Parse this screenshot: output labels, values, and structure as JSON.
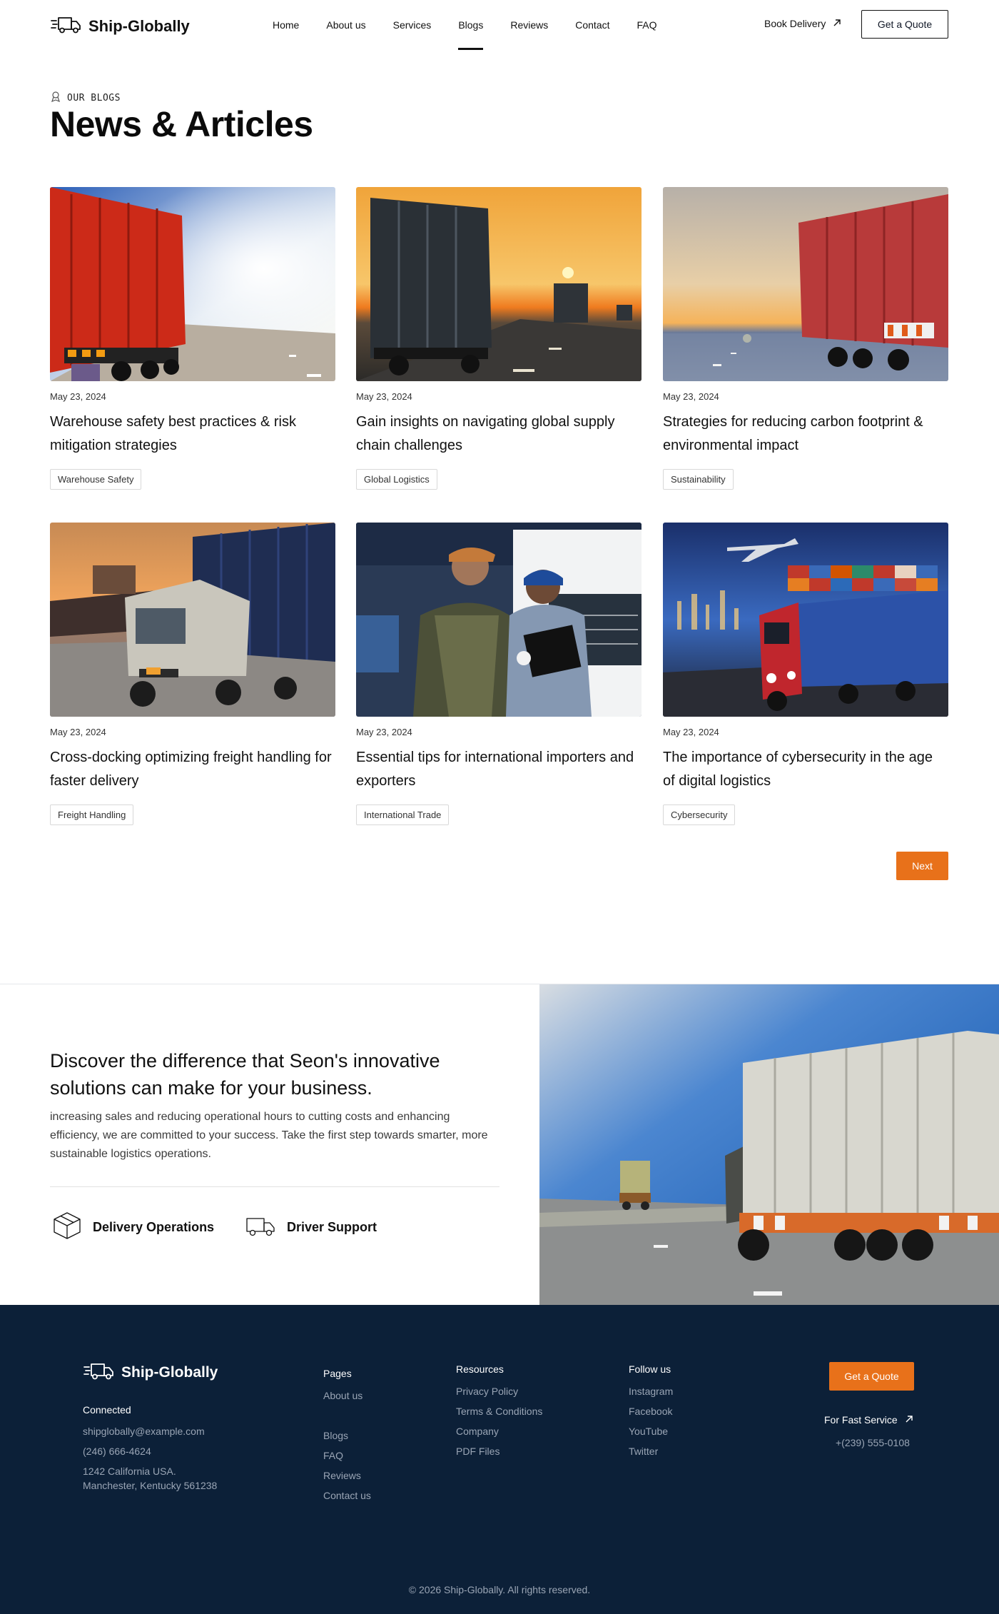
{
  "brand": {
    "name": "Ship-Globally"
  },
  "nav": {
    "items": [
      {
        "label": "Home"
      },
      {
        "label": "About us"
      },
      {
        "label": "Services"
      },
      {
        "label": "Blogs",
        "active": true
      },
      {
        "label": "Reviews"
      },
      {
        "label": "Contact"
      },
      {
        "label": "FAQ"
      }
    ],
    "book_label": "Book Delivery",
    "quote_label": "Get a Quote"
  },
  "blog": {
    "eyebrow": "OUR BLOGS",
    "title": "News & Articles",
    "posts": [
      {
        "date": "May 23, 2024",
        "title": "Warehouse safety best practices & risk mitigation strategies",
        "tag": "Warehouse Safety"
      },
      {
        "date": "May 23, 2024",
        "title": "Gain insights on navigating global supply chain challenges",
        "tag": "Global Logistics"
      },
      {
        "date": "May 23, 2024",
        "title": "Strategies for reducing carbon footprint & environmental impact",
        "tag": "Sustainability"
      },
      {
        "date": "May 23, 2024",
        "title": "Cross-docking optimizing freight handling for faster delivery",
        "tag": "Freight Handling"
      },
      {
        "date": "May 23, 2024",
        "title": "Essential tips for international importers and exporters",
        "tag": "International Trade"
      },
      {
        "date": "May 23, 2024",
        "title": "The importance of cybersecurity in the age of digital logistics",
        "tag": "Cybersecurity"
      }
    ],
    "next_label": "Next"
  },
  "cta": {
    "title": "Discover the difference that Seon's innovative solutions can make for your business.",
    "text": "increasing sales and reducing operational hours to cutting costs and enhancing efficiency, we are committed to your success. Take the first step towards smarter, more sustainable logistics operations.",
    "features": [
      {
        "label": "Delivery Operations",
        "icon": "box-icon"
      },
      {
        "label": "Driver Support",
        "icon": "truck-icon"
      }
    ]
  },
  "footer": {
    "connected_title": "Connected",
    "email": "shipglobally@example.com",
    "phone": "(246) 666-4624",
    "address_line1": "1242 California USA.",
    "address_line2": "Manchester, Kentucky 561238",
    "pages_title": "Pages",
    "pages": [
      "About us",
      "Blogs",
      "FAQ",
      "Reviews",
      "Contact us"
    ],
    "resources_title": "Resources",
    "resources": [
      "Privacy Policy",
      "Terms & Conditions",
      "Company",
      "PDF Files"
    ],
    "follow_title": "Follow us",
    "follow": [
      "Instagram",
      "Facebook",
      "YouTube",
      "Twitter"
    ],
    "quote_label": "Get a Quote",
    "fast_service_label": "For Fast Service",
    "fast_phone": "+(239) 555-0108",
    "copyright": "© 2026 Ship-Globally. All rights reserved."
  },
  "colors": {
    "accent": "#e8711a",
    "footer_bg": "#0c2038",
    "text": "#111827"
  }
}
